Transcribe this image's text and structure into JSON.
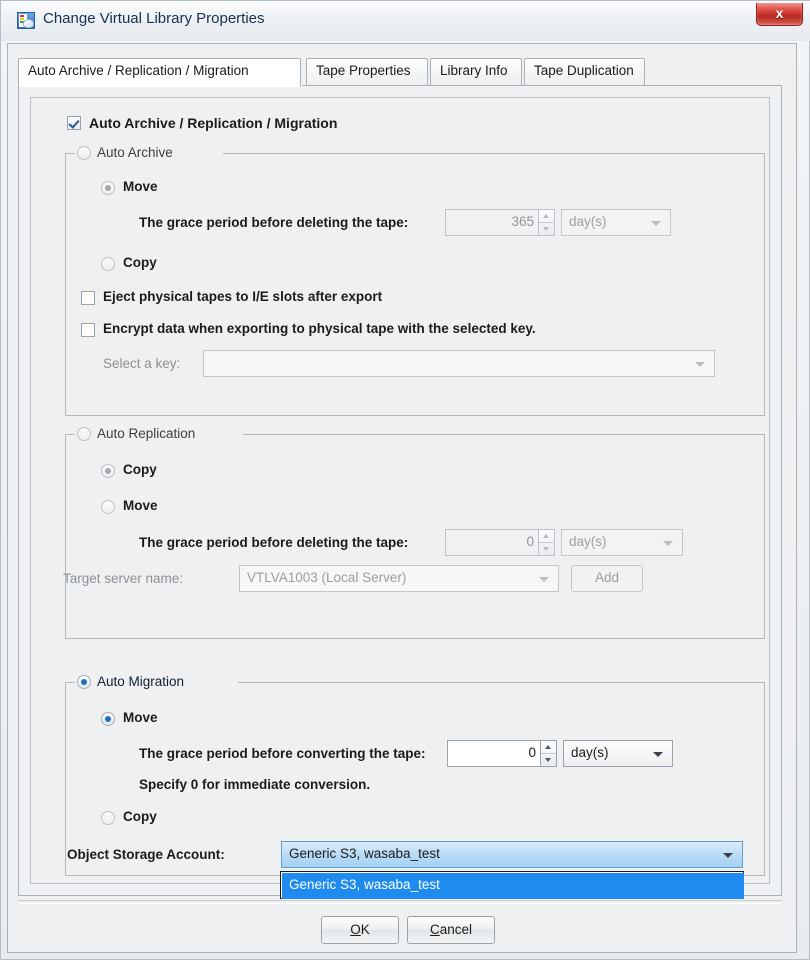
{
  "window": {
    "title": "Change Virtual Library Properties",
    "app_icon": "library-properties-icon",
    "close_label": "x"
  },
  "tabs": [
    {
      "label": "Auto Archive / Replication / Migration",
      "selected": true
    },
    {
      "label": "Tape Properties",
      "selected": false
    },
    {
      "label": "Library Info",
      "selected": false
    },
    {
      "label": "Tape Duplication",
      "selected": false
    }
  ],
  "master_checkbox": {
    "label": "Auto Archive / Replication / Migration",
    "checked": true
  },
  "auto_archive": {
    "group_label": "Auto Archive",
    "selected": false,
    "enabled": false,
    "move_label": "Move",
    "move_selected": true,
    "grace_label": "The grace period before deleting the tape:",
    "grace_value": "365",
    "grace_unit": "day(s)",
    "copy_label": "Copy",
    "copy_selected": false,
    "eject_label": "Eject physical tapes to I/E slots after export",
    "eject_checked": false,
    "encrypt_label": "Encrypt data when exporting to physical tape with the selected key.",
    "encrypt_checked": false,
    "select_key_label": "Select a key:",
    "select_key_value": ""
  },
  "auto_replication": {
    "group_label": "Auto Replication",
    "selected": false,
    "enabled": false,
    "copy_label": "Copy",
    "copy_selected": true,
    "move_label": "Move",
    "move_selected": false,
    "grace_label": "The grace period before deleting the tape:",
    "grace_value": "0",
    "grace_unit": "day(s)",
    "target_server_label": "Target server name:",
    "target_server_value": "VTLVA1003 (Local Server)",
    "add_button_label": "Add"
  },
  "auto_migration": {
    "group_label": "Auto Migration",
    "selected": true,
    "enabled": true,
    "move_label": "Move",
    "move_selected": true,
    "grace_label": "The grace period before converting the tape:",
    "grace_value": "0",
    "grace_unit": "day(s)",
    "hint_label": "Specify 0 for immediate conversion.",
    "copy_label": "Copy",
    "copy_selected": false,
    "object_storage_label": "Object Storage Account:",
    "object_storage_value": "Generic S3,   wasaba_test",
    "dropdown_open": true,
    "dropdown_options": [
      "Generic S3,   wasaba_test"
    ],
    "dropdown_selected_index": 0
  },
  "footer": {
    "ok_mnemonic": "O",
    "ok_rest": "K",
    "cancel_mnemonic": "C",
    "cancel_rest": "ancel"
  },
  "colors": {
    "accent_blue": "#1f8bef",
    "radio_dot": "#1d6fc4",
    "close_red": "#d9453c",
    "panel_bg": "#eff0f1"
  }
}
